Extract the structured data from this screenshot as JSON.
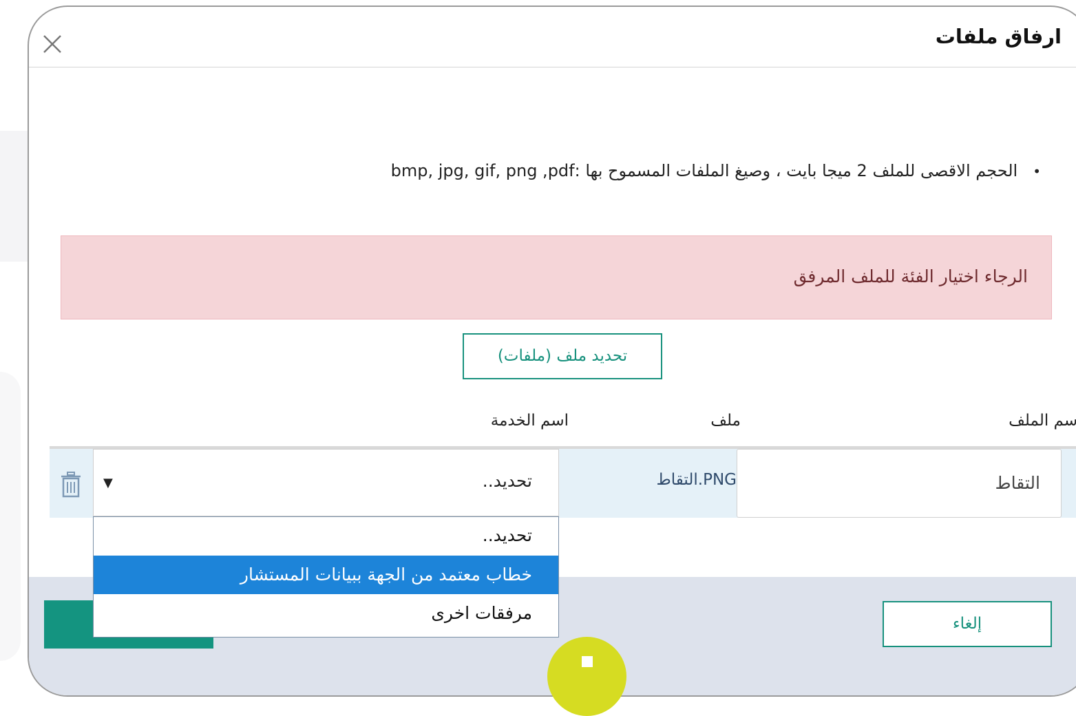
{
  "modal": {
    "title": "ارفاق ملفات"
  },
  "info": {
    "bullet": "•",
    "text": "الحجم الاقصى للملف 2 ميجا بايت ، وصيغ الملفات المسموح بها :bmp, jpg, gif, png ,pdf"
  },
  "alert": {
    "text": "الرجاء اختيار الفئة للملف المرفق"
  },
  "select_files_button": "تحديد ملف (ملفات)",
  "table": {
    "headers": {
      "file_name": "اسم الملف",
      "required_mark": "*",
      "file": "ملف",
      "service_name": "اسم الخدمة"
    },
    "row": {
      "file_name_value": "التقاط",
      "file": "التقاط.PNG",
      "service_selected": "تحديد.."
    }
  },
  "dropdown": {
    "options": [
      {
        "label": "تحديد..",
        "selected": false
      },
      {
        "label": "خطاب معتمد من الجهة ببيانات المستشار",
        "selected": true
      },
      {
        "label": "مرفقات اخرى",
        "selected": false
      }
    ]
  },
  "footer": {
    "cancel_label": "إلغاء"
  },
  "colors": {
    "accent": "#17917d",
    "alert_bg": "#f5d5d8",
    "selected_option": "#1d84d9",
    "row_bg": "#e5f1f8",
    "footer_bg": "#dde2ec"
  }
}
